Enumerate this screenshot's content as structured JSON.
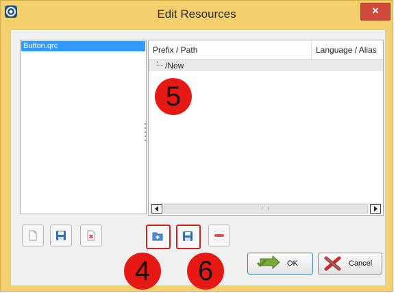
{
  "window": {
    "title": "Edit Resources",
    "close_label": "×"
  },
  "file_list": {
    "items": [
      "Button.qrc"
    ]
  },
  "tree": {
    "columns": [
      "Prefix / Path",
      "Language / Alias"
    ],
    "rows": [
      {
        "label": "/New"
      }
    ]
  },
  "buttons": {
    "ok_label": "OK",
    "cancel_label": "Cancel"
  },
  "callouts": [
    "5",
    "4",
    "6"
  ],
  "icons": {
    "app": "qt-designer-icon",
    "file_toolbar": [
      "new-file-icon",
      "save-icon",
      "remove-file-icon"
    ],
    "tree_toolbar": [
      "add-prefix-icon",
      "add-files-icon",
      "remove-icon"
    ],
    "ok": "green-check-arrow-icon",
    "cancel": "red-x-icon"
  },
  "colors": {
    "titlebar": "#f3cf6d",
    "selection": "#3399ff",
    "close": "#cf4a3c",
    "callout": "#e51a14",
    "highlight_border": "#d02020"
  }
}
